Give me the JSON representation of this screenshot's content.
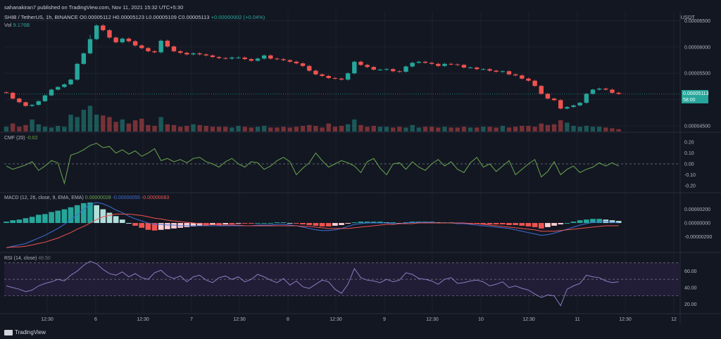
{
  "header": {
    "published": "sahanakiran7 published on TradingView.com, Nov 11, 2021 15:32 UTC+5:30",
    "currency": "USDT",
    "instrument": "SHIB / TetherUS, 1h, BINANCE",
    "ohlc": "O0.00005112 H0.00005123 L0.00005109 C0.00005113",
    "change": "+0.00000002 (+0.04%)",
    "vol_label": "Vol",
    "vol_value": "9.176B"
  },
  "price_tag": {
    "price": "0.00005113",
    "countdown": "58:00"
  },
  "panels": {
    "cmf_title": "CMF (20)",
    "cmf_value": "-0.02",
    "macd_title": "MACD (12, 26, close, 9, EMA, EMA)",
    "macd_hist": "0.00000028",
    "macd_line": "-0.00000055",
    "macd_signal": "-0.00000083",
    "rsi_title": "RSI (14, close)",
    "rsi_value": "48.50"
  },
  "colors": {
    "bg": "#131722",
    "up": "#26a69a",
    "down": "#ef5350",
    "cmf": "#6aa84f",
    "macd": "#3f6fd8",
    "signal": "#ef5350",
    "rsi": "#8e7cc3",
    "rsi_band": "#241e38"
  },
  "footer": {
    "brand": "TradingView"
  },
  "chart_data": [
    {
      "type": "candlestick",
      "name": "price",
      "x_ticks": [
        "12:30",
        "6",
        "12:30",
        "7",
        "12:30",
        "8",
        "12:30",
        "9",
        "12:30",
        "10",
        "12:30",
        "11",
        "12:30",
        "12"
      ],
      "y_ticks": [
        "0.00006500",
        "0.00006000",
        "0.00005500",
        "0.00004500"
      ],
      "ylim": [
        4.42e-05,
        6.6e-05
      ],
      "close": [
        5.13e-05,
        5.02e-05,
        4.95e-05,
        4.88e-05,
        4.9e-05,
        4.97e-05,
        5.08e-05,
        5.19e-05,
        5.24e-05,
        5.29e-05,
        5.38e-05,
        5.68e-05,
        5.88e-05,
        6.15e-05,
        6.41e-05,
        6.32e-05,
        6.18e-05,
        6.09e-05,
        6.16e-05,
        6.11e-05,
        6.03e-05,
        5.98e-05,
        5.92e-05,
        5.9e-05,
        6.12e-05,
        6.01e-05,
        5.92e-05,
        5.89e-05,
        5.86e-05,
        5.88e-05,
        5.86e-05,
        5.84e-05,
        5.81e-05,
        5.79e-05,
        5.78e-05,
        5.8e-05,
        5.8e-05,
        5.77e-05,
        5.74e-05,
        5.78e-05,
        5.84e-05,
        5.78e-05,
        5.77e-05,
        5.75e-05,
        5.72e-05,
        5.69e-05,
        5.64e-05,
        5.55e-05,
        5.48e-05,
        5.45e-05,
        5.41e-05,
        5.4e-05,
        5.38e-05,
        5.5e-05,
        5.72e-05,
        5.66e-05,
        5.62e-05,
        5.57e-05,
        5.57e-05,
        5.58e-05,
        5.54e-05,
        5.53e-05,
        5.63e-05,
        5.7e-05,
        5.72e-05,
        5.7e-05,
        5.68e-05,
        5.64e-05,
        5.68e-05,
        5.67e-05,
        5.66e-05,
        5.61e-05,
        5.61e-05,
        5.58e-05,
        5.58e-05,
        5.55e-05,
        5.53e-05,
        5.54e-05,
        5.48e-05,
        5.46e-05,
        5.4e-05,
        5.36e-05,
        5.26e-05,
        5.11e-05,
        5.02e-05,
        4.99e-05,
        4.83e-05,
        4.86e-05,
        4.89e-05,
        4.94e-05,
        5.11e-05,
        5.19e-05,
        5.21e-05,
        5.19e-05,
        5.13e-05,
        5.11e-05
      ]
    },
    {
      "type": "bar",
      "name": "volume",
      "values": [
        0.6,
        1.0,
        0.6,
        0.8,
        1.5,
        0.9,
        0.6,
        0.5,
        0.7,
        0.6,
        2.1,
        1.8,
        2.7,
        3.2,
        2.1,
        2.0,
        1.8,
        1.2,
        1.5,
        1.0,
        1.4,
        1.6,
        0.8,
        0.7,
        1.8,
        0.9,
        0.8,
        0.6,
        0.7,
        0.9,
        0.8,
        0.7,
        0.6,
        0.6,
        0.6,
        0.5,
        0.7,
        0.6,
        0.5,
        0.6,
        0.7,
        0.5,
        0.5,
        0.6,
        0.5,
        0.6,
        0.7,
        0.8,
        0.7,
        0.5,
        1.0,
        0.6,
        0.7,
        0.9,
        1.5,
        0.8,
        0.6,
        0.7,
        0.6,
        0.6,
        0.5,
        0.6,
        0.5,
        0.8,
        0.5,
        0.6,
        0.6,
        0.5,
        0.6,
        0.5,
        0.5,
        0.6,
        0.5,
        0.5,
        0.6,
        0.6,
        0.5,
        0.7,
        0.5,
        0.6,
        0.7,
        0.7,
        0.6,
        1.0,
        0.8,
        0.9,
        1.4,
        1.1,
        0.7,
        0.6,
        0.7,
        0.6,
        0.6,
        0.5,
        0.4,
        0.3
      ]
    },
    {
      "type": "line",
      "name": "CMF",
      "y_ticks": [
        "0.20",
        "0.10",
        "0.00",
        "-0.10",
        "-0.20"
      ],
      "ylim": [
        -0.24,
        0.24
      ],
      "values": [
        -0.02,
        -0.05,
        -0.03,
        -0.01,
        0.02,
        -0.06,
        -0.02,
        0.03,
        0.01,
        -0.18,
        0.08,
        0.1,
        0.13,
        0.17,
        0.19,
        0.15,
        0.16,
        0.1,
        0.13,
        0.09,
        0.12,
        0.07,
        0.1,
        0.14,
        0.03,
        0.05,
        0.02,
        0.04,
        0.01,
        0.05,
        0.06,
        0.02,
        0.0,
        -0.03,
        0.02,
        0.05,
        0.0,
        -0.03,
        0.02,
        0.01,
        -0.05,
        -0.02,
        0.03,
        0.06,
        0.02,
        -0.1,
        -0.04,
        0.01,
        0.1,
        0.03,
        -0.03,
        0.0,
        0.03,
        0.01,
        -0.02,
        -0.08,
        0.02,
        0.05,
        -0.04,
        -0.1,
        0.0,
        0.01,
        -0.05,
        0.02,
        -0.03,
        -0.06,
        0.0,
        0.04,
        -0.02,
        0.02,
        -0.05,
        -0.08,
        0.01,
        0.06,
        -0.03,
        0.0,
        -0.07,
        -0.02,
        0.03,
        -0.1,
        -0.05,
        0.0,
        0.04,
        -0.12,
        -0.07,
        0.02,
        -0.1,
        -0.05,
        -0.02,
        -0.08,
        -0.05,
        -0.03,
        0.01,
        -0.02,
        0.01,
        -0.02
      ]
    },
    {
      "type": "bar+line",
      "name": "MACD",
      "y_ticks": [
        "0.00000200",
        "0.00000000",
        "-0.00000200"
      ],
      "ylim": [
        -4e-07,
        3.6e-07
      ],
      "histogram": [
        0.02,
        0.04,
        0.05,
        0.07,
        0.09,
        0.12,
        0.13,
        0.16,
        0.18,
        0.2,
        0.23,
        0.26,
        0.29,
        0.3,
        0.26,
        0.2,
        0.15,
        0.1,
        0.05,
        0.0,
        -0.04,
        -0.07,
        -0.1,
        -0.11,
        -0.1,
        -0.09,
        -0.08,
        -0.07,
        -0.06,
        -0.05,
        -0.04,
        -0.04,
        -0.03,
        -0.03,
        -0.02,
        -0.02,
        -0.01,
        -0.01,
        -0.01,
        0.0,
        0.0,
        0.0,
        0.01,
        0.01,
        0.0,
        -0.01,
        -0.02,
        -0.03,
        -0.04,
        -0.05,
        -0.05,
        -0.04,
        -0.03,
        -0.01,
        0.01,
        0.02,
        0.02,
        0.02,
        0.02,
        0.01,
        0.01,
        0.0,
        0.01,
        0.02,
        0.02,
        0.02,
        0.02,
        0.01,
        0.01,
        0.01,
        0.0,
        0.0,
        -0.01,
        -0.01,
        -0.02,
        -0.02,
        -0.02,
        -0.02,
        -0.03,
        -0.03,
        -0.04,
        -0.05,
        -0.06,
        -0.08,
        -0.06,
        -0.04,
        -0.02,
        0.0,
        0.02,
        0.04,
        0.05,
        0.06,
        0.06,
        0.05,
        0.04,
        0.03
      ],
      "macd": [
        -0.36,
        -0.34,
        -0.32,
        -0.3,
        -0.26,
        -0.22,
        -0.18,
        -0.13,
        -0.08,
        -0.02,
        0.05,
        0.12,
        0.2,
        0.27,
        0.3,
        0.28,
        0.24,
        0.19,
        0.15,
        0.1,
        0.06,
        0.03,
        0.0,
        -0.02,
        -0.02,
        -0.03,
        -0.03,
        -0.04,
        -0.04,
        -0.04,
        -0.04,
        -0.04,
        -0.04,
        -0.04,
        -0.04,
        -0.04,
        -0.04,
        -0.04,
        -0.04,
        -0.03,
        -0.03,
        -0.03,
        -0.02,
        -0.02,
        -0.03,
        -0.04,
        -0.06,
        -0.08,
        -0.1,
        -0.11,
        -0.11,
        -0.1,
        -0.08,
        -0.05,
        -0.02,
        -0.01,
        0.0,
        0.0,
        0.0,
        0.0,
        -0.01,
        -0.01,
        0.0,
        0.01,
        0.01,
        0.01,
        0.01,
        0.0,
        0.0,
        0.0,
        -0.01,
        -0.01,
        -0.02,
        -0.03,
        -0.04,
        -0.05,
        -0.06,
        -0.07,
        -0.08,
        -0.1,
        -0.12,
        -0.14,
        -0.16,
        -0.18,
        -0.17,
        -0.15,
        -0.12,
        -0.09,
        -0.06,
        -0.03,
        -0.01,
        0.01,
        0.02,
        0.02,
        0.01,
        0.0
      ],
      "signal": [
        -0.36,
        -0.35,
        -0.35,
        -0.34,
        -0.32,
        -0.3,
        -0.28,
        -0.25,
        -0.22,
        -0.18,
        -0.14,
        -0.09,
        -0.05,
        0.0,
        0.05,
        0.09,
        0.11,
        0.13,
        0.13,
        0.13,
        0.12,
        0.11,
        0.09,
        0.07,
        0.06,
        0.04,
        0.03,
        0.02,
        0.01,
        0.0,
        -0.01,
        -0.02,
        -0.02,
        -0.03,
        -0.03,
        -0.03,
        -0.03,
        -0.04,
        -0.04,
        -0.04,
        -0.04,
        -0.04,
        -0.04,
        -0.04,
        -0.04,
        -0.04,
        -0.05,
        -0.05,
        -0.06,
        -0.07,
        -0.08,
        -0.08,
        -0.08,
        -0.08,
        -0.07,
        -0.06,
        -0.05,
        -0.04,
        -0.03,
        -0.02,
        -0.02,
        -0.01,
        -0.01,
        -0.01,
        0.0,
        0.0,
        0.0,
        0.0,
        0.0,
        0.0,
        0.0,
        0.0,
        -0.01,
        -0.01,
        -0.02,
        -0.03,
        -0.04,
        -0.05,
        -0.06,
        -0.07,
        -0.08,
        -0.09,
        -0.1,
        -0.12,
        -0.12,
        -0.12,
        -0.11,
        -0.1,
        -0.09,
        -0.08,
        -0.07,
        -0.06,
        -0.05,
        -0.04,
        -0.04,
        -0.04
      ]
    },
    {
      "type": "line",
      "name": "RSI",
      "y_ticks": [
        "60.00",
        "40.00",
        "20.00"
      ],
      "ylim": [
        10,
        80
      ],
      "band": [
        30,
        70
      ],
      "values": [
        42,
        40,
        38,
        35,
        37,
        42,
        45,
        47,
        50,
        48,
        55,
        60,
        67,
        72,
        69,
        62,
        57,
        55,
        59,
        53,
        57,
        52,
        50,
        58,
        61,
        54,
        51,
        54,
        47,
        53,
        55,
        49,
        46,
        52,
        54,
        50,
        53,
        47,
        50,
        56,
        53,
        49,
        46,
        51,
        43,
        48,
        41,
        39,
        44,
        49,
        47,
        38,
        33,
        44,
        63,
        52,
        49,
        48,
        46,
        50,
        47,
        49,
        58,
        56,
        51,
        50,
        48,
        44,
        50,
        52,
        45,
        46,
        48,
        49,
        47,
        42,
        44,
        47,
        40,
        42,
        39,
        37,
        32,
        28,
        31,
        30,
        18,
        38,
        42,
        45,
        55,
        53,
        52,
        48,
        46,
        47
      ]
    }
  ]
}
